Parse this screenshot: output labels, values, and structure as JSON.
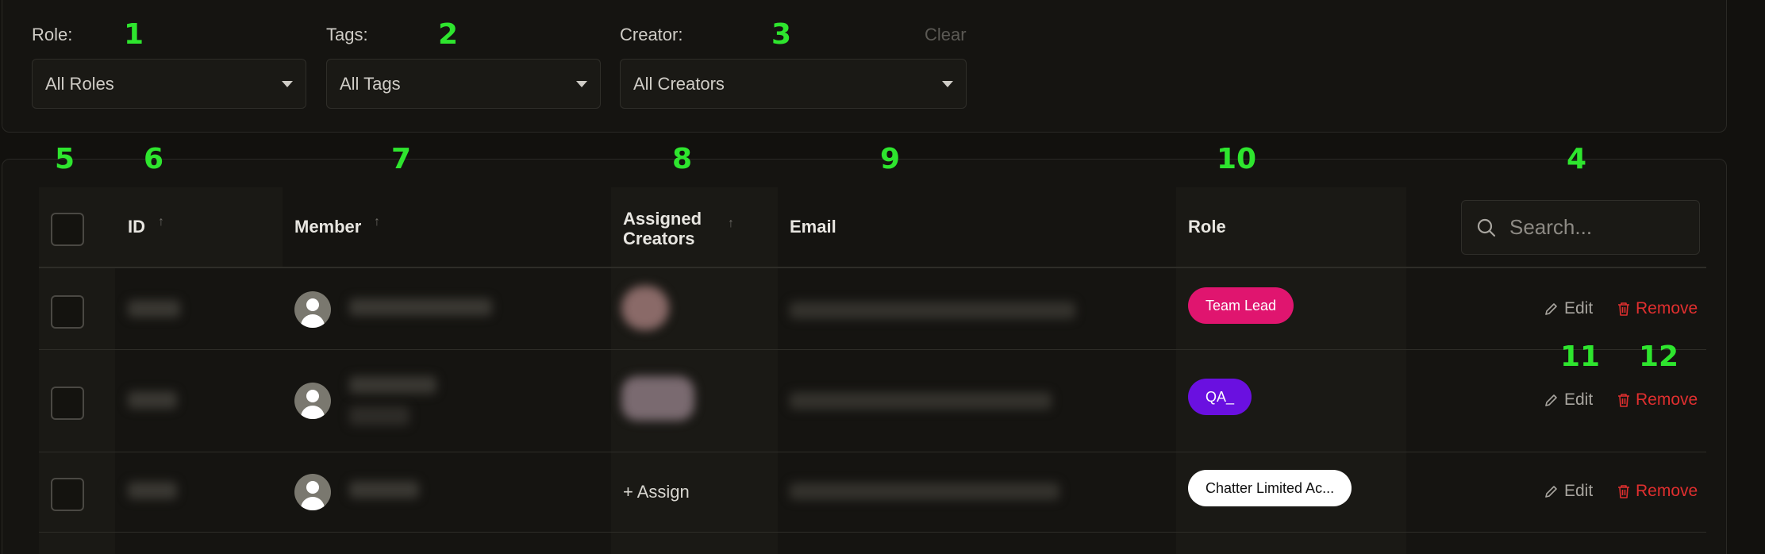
{
  "filters": {
    "role": {
      "label": "Role:",
      "value": "All Roles"
    },
    "tags": {
      "label": "Tags:",
      "value": "All Tags"
    },
    "creator": {
      "label": "Creator:",
      "value": "All Creators"
    },
    "clear_label": "Clear"
  },
  "markers": [
    "1",
    "2",
    "3",
    "4",
    "5",
    "6",
    "7",
    "8",
    "9",
    "10",
    "11",
    "12"
  ],
  "table": {
    "headers": {
      "id": "ID",
      "member": "Member",
      "assigned_creators_1": "Assigned",
      "assigned_creators_2": "Creators",
      "email": "Email",
      "role": "Role"
    },
    "search_placeholder": "Search...",
    "edit_label": "Edit",
    "remove_label": "Remove",
    "assign_label": "+ Assign",
    "rows": [
      {
        "role": "Team Lead",
        "role_color": "#e0156f",
        "role_text_color": "#ffffff"
      },
      {
        "role": "QA_",
        "role_color": "#6a10e0",
        "role_text_color": "#ffffff"
      },
      {
        "role": "Chatter Limited Ac...",
        "role_color": "#ffffff",
        "role_text_color": "#111111"
      }
    ]
  },
  "colors": {
    "marker": "#2ee52e",
    "remove": "#e02f2f"
  }
}
